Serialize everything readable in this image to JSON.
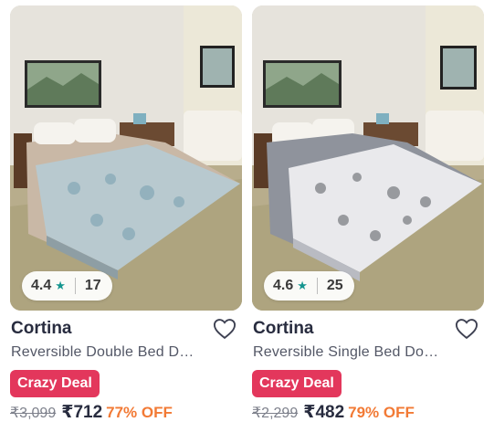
{
  "products": [
    {
      "rating": "4.4",
      "rating_count": "17",
      "brand": "Cortina",
      "title": "Reversible Double Bed D…",
      "deal_badge": "Crazy Deal",
      "mrp": "₹3,099",
      "price": "₹712",
      "discount": "77% OFF",
      "quilt_color": "#b8c9cf"
    },
    {
      "rating": "4.6",
      "rating_count": "25",
      "brand": "Cortina",
      "title": "Reversible Single Bed Do…",
      "deal_badge": "Crazy Deal",
      "mrp": "₹2,299",
      "price": "₹482",
      "discount": "79% OFF",
      "quilt_color": "#9a9ea8"
    }
  ],
  "colors": {
    "deal_badge": "#e3375c",
    "discount": "#f27a35",
    "star": "#14958f",
    "brand_text": "#282c3f"
  },
  "icons": {
    "rating": "star-icon",
    "wishlist": "heart-outline-icon"
  }
}
